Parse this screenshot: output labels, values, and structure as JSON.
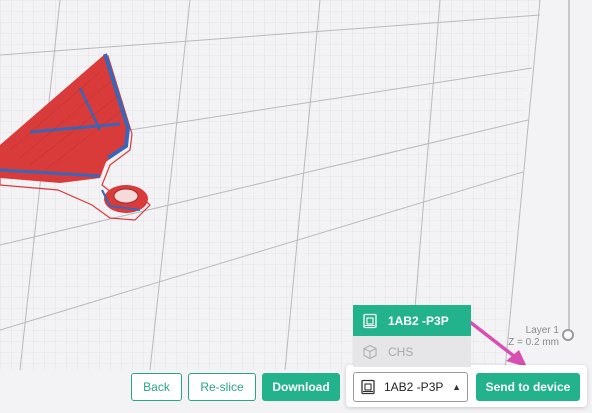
{
  "layer_indicator": {
    "name": "Layer 1",
    "z_readout": "Z = 0.2 mm"
  },
  "actions": {
    "back_label": "Back",
    "reslice_label": "Re-slice",
    "download_label": "Download",
    "send_label": "Send to device"
  },
  "device_select": {
    "selected": "1AB2 -P3P",
    "icon": "printer-icon",
    "caret_icon": "caret-up-icon"
  },
  "device_menu": {
    "items": [
      {
        "label": "1AB2 -P3P",
        "icon": "printer-icon",
        "state": "selected"
      },
      {
        "label": "CHS",
        "icon": "cube-icon",
        "state": "disabled"
      }
    ]
  },
  "colors": {
    "accent": "#22b28c",
    "model": "#d93a3a",
    "model_edge": "#3a66b8",
    "annotation_arrow": "#d84fb4"
  }
}
